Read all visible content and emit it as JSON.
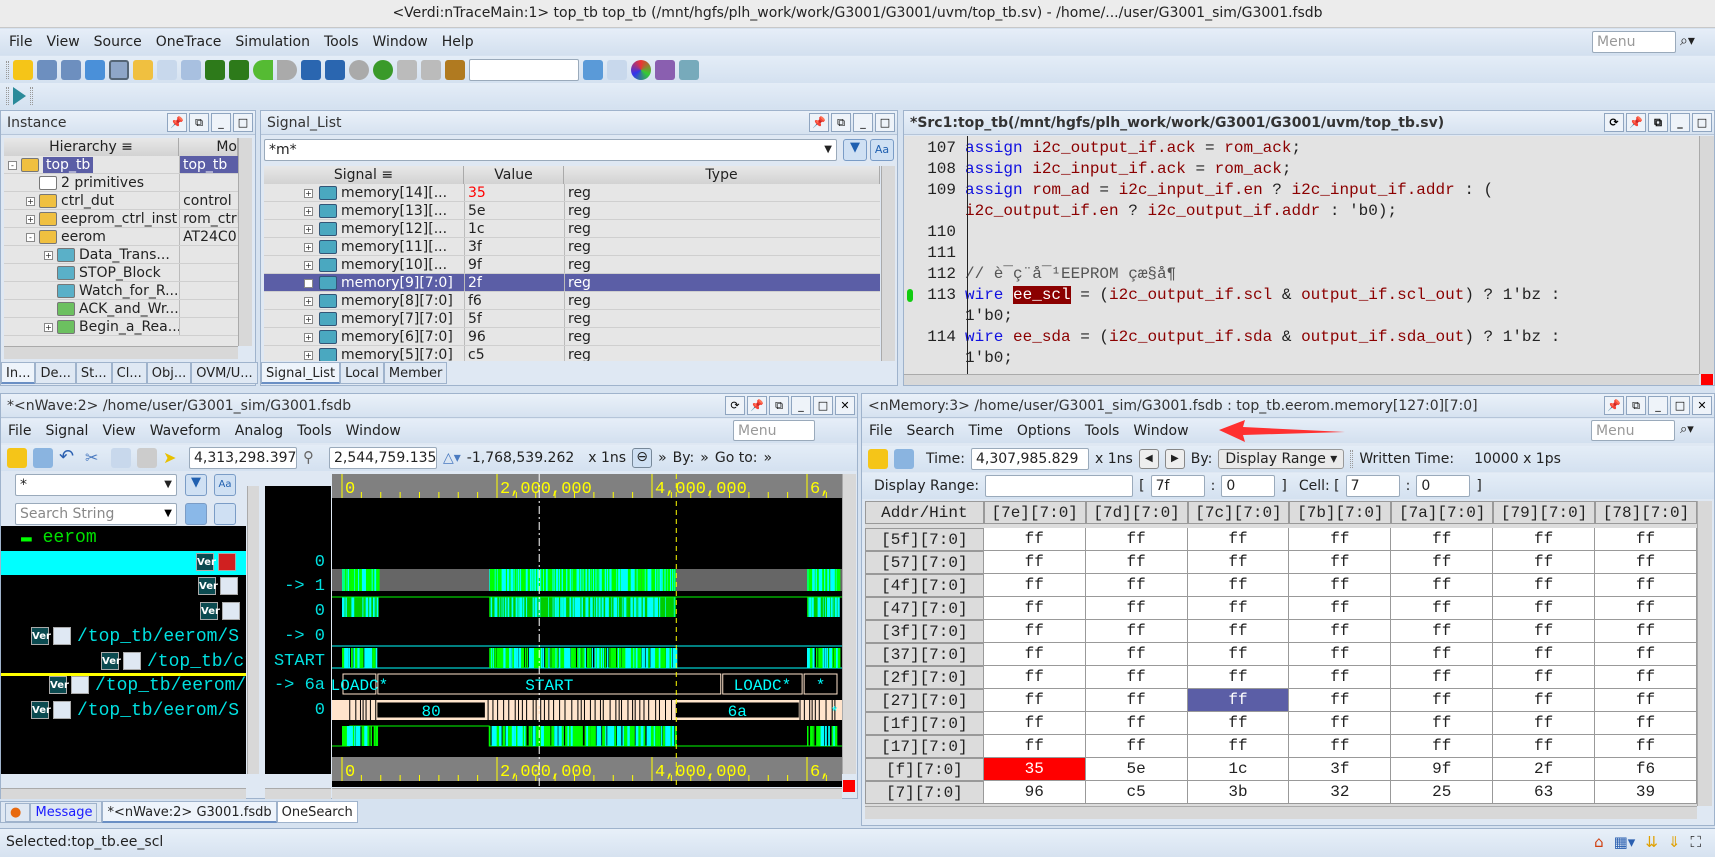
{
  "window": {
    "title": "<Verdi:nTraceMain:1> top_tb top_tb (/mnt/hgfs/plh_work/work/G3001/G3001/uvm/top_tb.sv) - /home/.../user/G3001_sim/G3001.fsdb"
  },
  "menu": [
    "File",
    "View",
    "Source",
    "OneTrace",
    "Simulation",
    "Tools",
    "Window",
    "Help"
  ],
  "menu_search_placeholder": "Menu",
  "instance": {
    "title": "Instance",
    "columns": [
      "Hierarchy",
      "Mo"
    ],
    "rows": [
      {
        "name": "top_tb",
        "module": "top_tb",
        "indent": 0,
        "fold": "-",
        "icon": "module",
        "selected": true
      },
      {
        "name": "2 primitives",
        "module": "",
        "indent": 1,
        "fold": "",
        "icon": "primitives"
      },
      {
        "name": "ctrl_dut",
        "module": "control",
        "indent": 1,
        "fold": "+",
        "icon": "module"
      },
      {
        "name": "eeprom_ctrl_inst",
        "module": "rom_ctrl",
        "indent": 1,
        "fold": "+",
        "icon": "module"
      },
      {
        "name": "eerom",
        "module": "AT24C0",
        "indent": 1,
        "fold": "-",
        "icon": "module"
      },
      {
        "name": "Data_Trans...",
        "module": "",
        "indent": 2,
        "fold": "+",
        "icon": "named-block"
      },
      {
        "name": "STOP_Block",
        "module": "",
        "indent": 2,
        "fold": "",
        "icon": "named-block"
      },
      {
        "name": "Watch_for_R...",
        "module": "",
        "indent": 2,
        "fold": "",
        "icon": "named-block"
      },
      {
        "name": "ACK_and_Wr...",
        "module": "",
        "indent": 2,
        "fold": "",
        "icon": "task"
      },
      {
        "name": "Begin_a_Rea...",
        "module": "",
        "indent": 2,
        "fold": "+",
        "icon": "task"
      }
    ],
    "tabs": [
      "In...",
      "De...",
      "St...",
      "Cl...",
      "Obj...",
      "OVM/U..."
    ]
  },
  "signal_list": {
    "title": "Signal_List",
    "filter": "*m*",
    "columns": [
      "Signal",
      "Value",
      "Type"
    ],
    "rows": [
      {
        "name": "memory[14][...",
        "value": "35",
        "type": "reg",
        "changed": true
      },
      {
        "name": "memory[13][...",
        "value": "5e",
        "type": "reg"
      },
      {
        "name": "memory[12][...",
        "value": "1c",
        "type": "reg"
      },
      {
        "name": "memory[11][...",
        "value": "3f",
        "type": "reg"
      },
      {
        "name": "memory[10][...",
        "value": "9f",
        "type": "reg"
      },
      {
        "name": "memory[9][7:0]",
        "value": "2f",
        "type": "reg",
        "selected": true
      },
      {
        "name": "memory[8][7:0]",
        "value": "f6",
        "type": "reg"
      },
      {
        "name": "memory[7][7:0]",
        "value": "5f",
        "type": "reg"
      },
      {
        "name": "memory[6][7:0]",
        "value": "96",
        "type": "reg"
      },
      {
        "name": "memory[5][7:0]",
        "value": "c5",
        "type": "reg"
      }
    ],
    "tabs": [
      "Signal_List",
      "Local",
      "Member"
    ]
  },
  "source": {
    "title": "*Src1:top_tb(/mnt/hgfs/plh_work/work/G3001/G3001/uvm/top_tb.sv)",
    "lines": [
      {
        "no": "107",
        "tokens": [
          [
            "assign ",
            "kw"
          ],
          [
            "i2c_output_if.ack",
            "id"
          ],
          [
            " = ",
            "op"
          ],
          [
            "rom_ack",
            "id"
          ],
          [
            ";",
            "op"
          ]
        ]
      },
      {
        "no": "108",
        "tokens": [
          [
            "assign ",
            "kw"
          ],
          [
            "i2c_input_if.ack",
            "id"
          ],
          [
            " = ",
            "op"
          ],
          [
            "rom_ack",
            "id"
          ],
          [
            ";",
            "op"
          ]
        ]
      },
      {
        "no": "109",
        "tokens": [
          [
            "assign ",
            "kw"
          ],
          [
            "rom_ad",
            "id"
          ],
          [
            " = ",
            "op"
          ],
          [
            "i2c_input_if.en",
            "id"
          ],
          [
            " ? ",
            "op"
          ],
          [
            "i2c_input_if.addr",
            "id"
          ],
          [
            " : (",
            "op"
          ]
        ]
      },
      {
        "no": "",
        "tokens": [
          [
            "i2c_output_if.en",
            "id"
          ],
          [
            " ? ",
            "op"
          ],
          [
            "i2c_output_if.addr",
            "id"
          ],
          [
            " : 'b0);",
            "op"
          ]
        ]
      },
      {
        "no": "110",
        "tokens": []
      },
      {
        "no": "111",
        "tokens": []
      },
      {
        "no": "112",
        "tokens": [
          [
            "// è¯­ç¨å¯¹EEPROM çæ§å¶",
            "cm"
          ]
        ]
      },
      {
        "no": "113",
        "marker": true,
        "tokens": [
          [
            "wire ",
            "kw"
          ],
          [
            "ee_scl",
            "hl"
          ],
          [
            " = (",
            "op"
          ],
          [
            "i2c_output_if.scl",
            "id"
          ],
          [
            " & ",
            "op"
          ],
          [
            "output_if.scl_out",
            "id"
          ],
          [
            ") ? 1'bz :",
            "op"
          ]
        ]
      },
      {
        "no": "",
        "tokens": [
          [
            "1'b0;",
            "op"
          ]
        ]
      },
      {
        "no": "114",
        "tokens": [
          [
            "wire ",
            "kw"
          ],
          [
            "ee_sda",
            "id"
          ],
          [
            " = (",
            "op"
          ],
          [
            "i2c_output_if.sda",
            "id"
          ],
          [
            " & ",
            "op"
          ],
          [
            "output_if.sda_out",
            "id"
          ],
          [
            ") ? 1'bz :",
            "op"
          ]
        ]
      },
      {
        "no": "",
        "tokens": [
          [
            "1'b0;",
            "op"
          ]
        ]
      }
    ]
  },
  "nwave": {
    "title": "*<nWave:2> /home/user/G3001_sim/G3001.fsdb",
    "menu": [
      "File",
      "Signal",
      "View",
      "Waveform",
      "Analog",
      "Tools",
      "Window"
    ],
    "menu_search_placeholder": "Menu",
    "cursor_time": "4,313,298.397",
    "marker_time": "2,544,759.135",
    "delta_time": "-1,768,539.262",
    "unit": "x 1ns",
    "by_label": "By:",
    "goto_label": "Go to:",
    "filter": "*",
    "search_placeholder": "Search String",
    "group": "eerom",
    "signals": [
      {
        "name": "",
        "value": "0",
        "highlight": true
      },
      {
        "name": "",
        "value": "-> 1"
      },
      {
        "name": "",
        "value": "0"
      },
      {
        "name": "/top_tb/eerom/S",
        "value": "-> 0"
      },
      {
        "name": "/top_tb/ctr",
        "value": "START"
      },
      {
        "name": "/top_tb/eerom/S_B",
        "value": "-> 6a"
      },
      {
        "name": "/top_tb/eerom/S",
        "value": "0"
      }
    ],
    "ruler_labels": [
      "0",
      "2,000,000",
      "4,000,000",
      "6,"
    ],
    "bus_labels": {
      "state": [
        "LOADC*",
        "START",
        "LOADC*",
        "*"
      ],
      "data": [
        "80",
        "6a",
        "*"
      ]
    }
  },
  "bottom_tabs": [
    "Message",
    "*<nWave:2> G3001.fsdb",
    "OneSearch"
  ],
  "status": "Selected:top_tb.ee_scl",
  "nmemory": {
    "title": "<nMemory:3> /home/user/G3001_sim/G3001.fsdb : top_tb.eerom.memory[127:0][7:0]",
    "menu": [
      "File",
      "Search",
      "Time",
      "Options",
      "Tools",
      "Window"
    ],
    "menu_search_placeholder": "Menu",
    "time_label": "Time:",
    "time": "4,307,985.829",
    "unit": "x 1ns",
    "by_label": "By:",
    "by_value": "Display Range",
    "written_label": "Written Time:",
    "written_value": "10000 x 1ps",
    "range_label": "Display Range:",
    "range_value": "",
    "range_hi": "7f",
    "range_lo": "0",
    "cell_label": "Cell: [",
    "cell_hi": "7",
    "cell_lo": "0",
    "lbr": "[",
    "rbr": "]",
    "colon": ":",
    "addr_header": "Addr/Hint",
    "columns": [
      "[7e][7:0]",
      "[7d][7:0]",
      "[7c][7:0]",
      "[7b][7:0]",
      "[7a][7:0]",
      "[79][7:0]",
      "[78][7:0]"
    ],
    "rows": [
      {
        "addr": "[5f][7:0]",
        "values": [
          "ff",
          "ff",
          "ff",
          "ff",
          "ff",
          "ff",
          "ff"
        ]
      },
      {
        "addr": "[57][7:0]",
        "values": [
          "ff",
          "ff",
          "ff",
          "ff",
          "ff",
          "ff",
          "ff"
        ]
      },
      {
        "addr": "[4f][7:0]",
        "values": [
          "ff",
          "ff",
          "ff",
          "ff",
          "ff",
          "ff",
          "ff"
        ]
      },
      {
        "addr": "[47][7:0]",
        "values": [
          "ff",
          "ff",
          "ff",
          "ff",
          "ff",
          "ff",
          "ff"
        ]
      },
      {
        "addr": "[3f][7:0]",
        "values": [
          "ff",
          "ff",
          "ff",
          "ff",
          "ff",
          "ff",
          "ff"
        ]
      },
      {
        "addr": "[37][7:0]",
        "values": [
          "ff",
          "ff",
          "ff",
          "ff",
          "ff",
          "ff",
          "ff"
        ]
      },
      {
        "addr": "[2f][7:0]",
        "values": [
          "ff",
          "ff",
          "ff",
          "ff",
          "ff",
          "ff",
          "ff"
        ]
      },
      {
        "addr": "[27][7:0]",
        "values": [
          "ff",
          "ff",
          "ff",
          "ff",
          "ff",
          "ff",
          "ff"
        ],
        "selected_col": 2
      },
      {
        "addr": "[1f][7:0]",
        "values": [
          "ff",
          "ff",
          "ff",
          "ff",
          "ff",
          "ff",
          "ff"
        ]
      },
      {
        "addr": "[17][7:0]",
        "values": [
          "ff",
          "ff",
          "ff",
          "ff",
          "ff",
          "ff",
          "ff"
        ]
      },
      {
        "addr": "[f][7:0]",
        "values": [
          "35",
          "5e",
          "1c",
          "3f",
          "9f",
          "2f",
          "f6"
        ],
        "changed_col": 0
      },
      {
        "addr": "[7][7:0]",
        "values": [
          "96",
          "c5",
          "3b",
          "32",
          "25",
          "63",
          "39"
        ]
      }
    ]
  },
  "colors": {
    "selection": "#5b5ea6",
    "changed": "#ff0000",
    "wave_cyan": "#00ffff",
    "wave_green": "#00ff00",
    "bus_fill": "#ffe4cc",
    "annotation": "#ff3030"
  }
}
